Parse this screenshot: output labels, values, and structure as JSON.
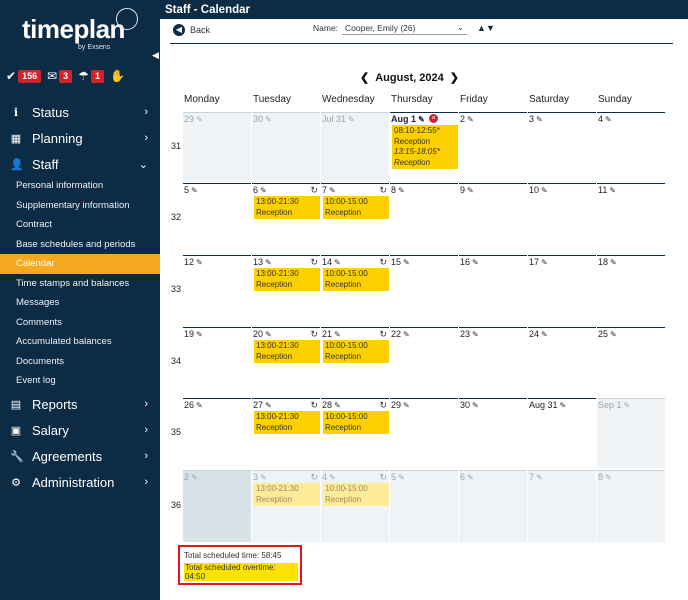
{
  "sidebar": {
    "logo_text": "timeplan",
    "logo_by": "by Exsens",
    "badges": [
      {
        "icon": "check-icon",
        "count": "156"
      },
      {
        "icon": "mail-icon",
        "count": "3"
      },
      {
        "icon": "umbrella-icon",
        "count": "1"
      },
      {
        "icon": "hand-icon",
        "count": ""
      }
    ],
    "nav": [
      {
        "label": "Status",
        "icon": "info-icon"
      },
      {
        "label": "Planning",
        "icon": "calendar-icon"
      },
      {
        "label": "Staff",
        "icon": "person-icon"
      },
      {
        "label": "Reports",
        "icon": "document-icon"
      },
      {
        "label": "Salary",
        "icon": "money-icon"
      },
      {
        "label": "Agreements",
        "icon": "wrench-icon"
      },
      {
        "label": "Administration",
        "icon": "cogs-icon"
      }
    ],
    "staff_items": [
      "Personal information",
      "Supplementary information",
      "Contract",
      "Base schedules and periods",
      "Calendar",
      "Time stamps and balances",
      "Messages",
      "Comments",
      "Accumulated balances",
      "Documents",
      "Event log"
    ],
    "active_item": "Calendar"
  },
  "header": {
    "title": "Staff - Calendar",
    "back_label": "Back",
    "name_label": "Name:",
    "name_value": "Cooper, Emily (26)",
    "month_label": "August,  2024"
  },
  "calendar": {
    "days": [
      "Monday",
      "Tuesday",
      "Wednesday",
      "Thursday",
      "Friday",
      "Saturday",
      "Sunday"
    ],
    "weeks": [
      {
        "num": "31",
        "cells": [
          {
            "d": "29",
            "o": true,
            "g": true
          },
          {
            "d": "30",
            "o": true,
            "g": true
          },
          {
            "d": "Jul 31",
            "o": true,
            "g": true
          },
          {
            "d": "Aug 1",
            "b": true,
            "x": true,
            "s": [
              {
                "t": "08:10-12:55*"
              },
              {
                "t": "Reception"
              },
              {
                "t": "13:15-18:05*",
                "i": true
              },
              {
                "t": "Reception",
                "i": true
              }
            ]
          },
          {
            "d": "2"
          },
          {
            "d": "3"
          },
          {
            "d": "4"
          }
        ]
      },
      {
        "num": "32",
        "cells": [
          {
            "d": "5"
          },
          {
            "d": "6",
            "r": true,
            "s": [
              {
                "t": "13:00-21:30"
              },
              {
                "t": "Reception"
              }
            ]
          },
          {
            "d": "7",
            "r": true,
            "s": [
              {
                "t": "10:00-15:00"
              },
              {
                "t": "Reception"
              }
            ]
          },
          {
            "d": "8"
          },
          {
            "d": "9"
          },
          {
            "d": "10"
          },
          {
            "d": "11"
          }
        ]
      },
      {
        "num": "33",
        "cells": [
          {
            "d": "12"
          },
          {
            "d": "13",
            "r": true,
            "s": [
              {
                "t": "13:00-21:30"
              },
              {
                "t": "Reception"
              }
            ]
          },
          {
            "d": "14",
            "r": true,
            "s": [
              {
                "t": "10:00-15:00"
              },
              {
                "t": "Reception"
              }
            ]
          },
          {
            "d": "15"
          },
          {
            "d": "16"
          },
          {
            "d": "17"
          },
          {
            "d": "18"
          }
        ]
      },
      {
        "num": "34",
        "cells": [
          {
            "d": "19"
          },
          {
            "d": "20",
            "r": true,
            "s": [
              {
                "t": "13:00-21:30"
              },
              {
                "t": "Reception"
              }
            ]
          },
          {
            "d": "21",
            "r": true,
            "s": [
              {
                "t": "10:00-15:00"
              },
              {
                "t": "Reception"
              }
            ]
          },
          {
            "d": "22"
          },
          {
            "d": "23"
          },
          {
            "d": "24"
          },
          {
            "d": "25"
          }
        ]
      },
      {
        "num": "35",
        "cells": [
          {
            "d": "26"
          },
          {
            "d": "27",
            "r": true,
            "s": [
              {
                "t": "13:00-21:30"
              },
              {
                "t": "Reception"
              }
            ]
          },
          {
            "d": "28",
            "r": true,
            "s": [
              {
                "t": "10:00-15:00"
              },
              {
                "t": "Reception"
              }
            ]
          },
          {
            "d": "29"
          },
          {
            "d": "30"
          },
          {
            "d": "Aug 31"
          },
          {
            "d": "Sep 1",
            "o": true,
            "g": true
          }
        ]
      },
      {
        "num": "36",
        "cells": [
          {
            "d": "2",
            "o": true,
            "g": true,
            "h": true
          },
          {
            "d": "3",
            "o": true,
            "g": true,
            "r": true,
            "s": [
              {
                "t": "13:00-21:30"
              },
              {
                "t": "Reception"
              }
            ]
          },
          {
            "d": "4",
            "o": true,
            "g": true,
            "r": true,
            "s": [
              {
                "t": "10:00-15:00"
              },
              {
                "t": "Reception"
              }
            ]
          },
          {
            "d": "5",
            "o": true,
            "g": true
          },
          {
            "d": "6",
            "o": true,
            "g": true
          },
          {
            "d": "7",
            "o": true,
            "g": true
          },
          {
            "d": "8",
            "o": true,
            "g": true
          }
        ]
      }
    ]
  },
  "totals": {
    "scheduled": "Total scheduled time: 58:45",
    "overtime": "Total scheduled overtime: 04:50"
  },
  "colors": {
    "navy": "#0c2b44",
    "accent": "#f5a91e",
    "shift": "#fdd000",
    "badge": "#d2232a"
  }
}
